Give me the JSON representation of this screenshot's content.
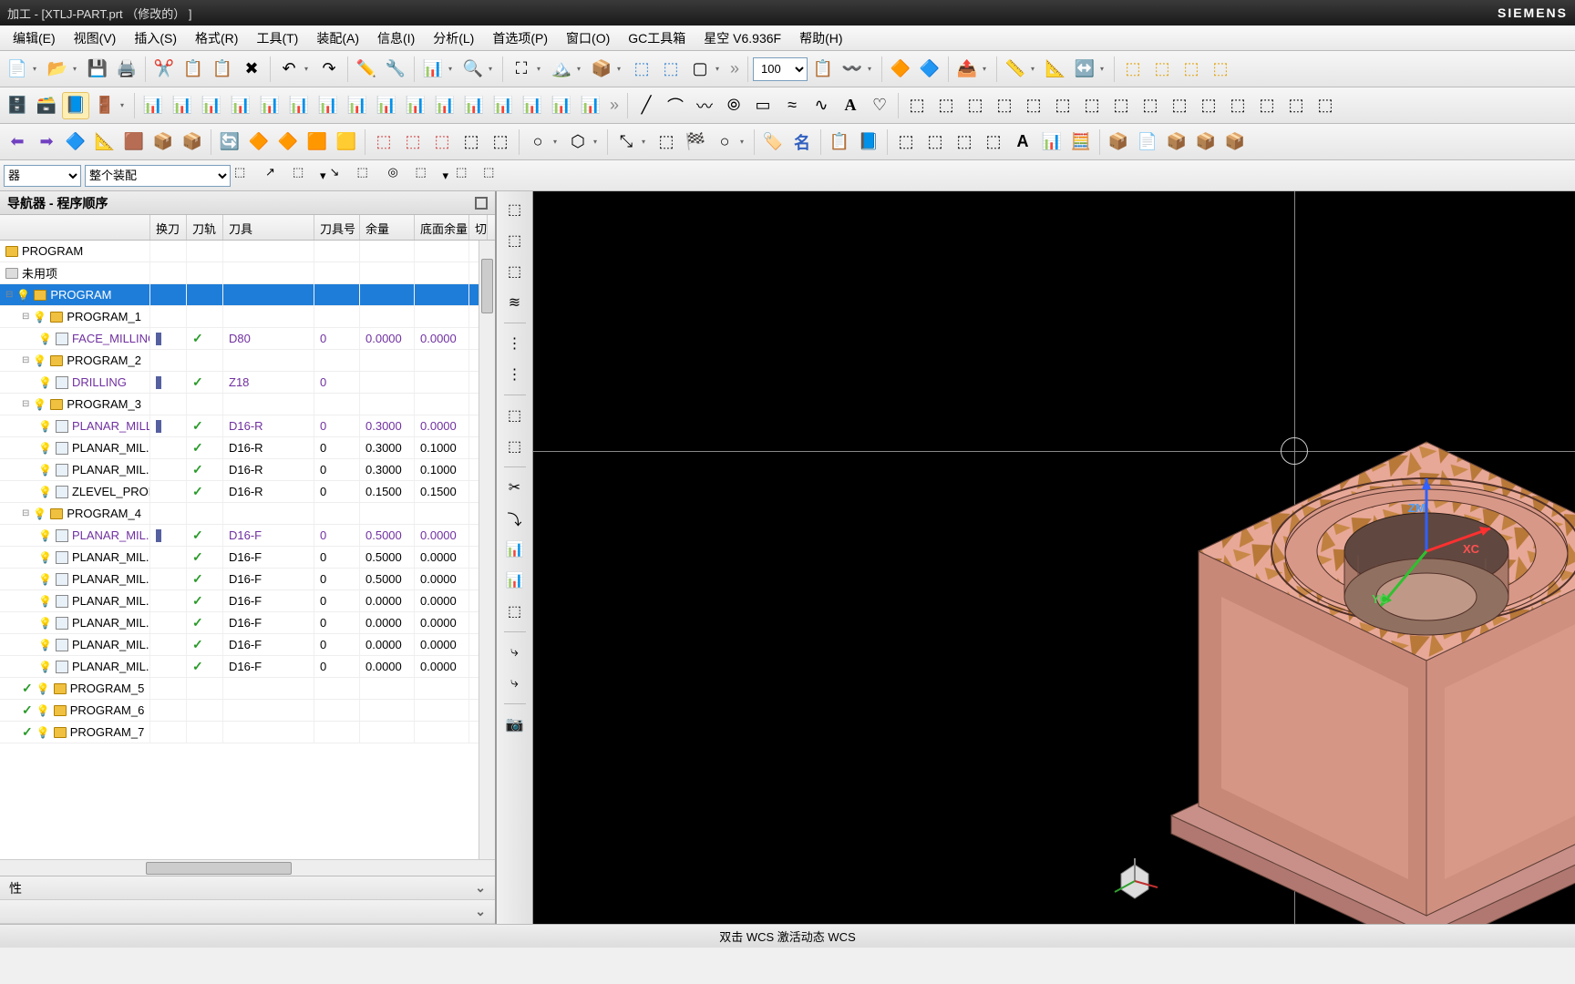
{
  "title": "加工 - [XTLJ-PART.prt  （修改的） ]",
  "brand": "SIEMENS",
  "menu": [
    "编辑(E)",
    "视图(V)",
    "插入(S)",
    "格式(R)",
    "工具(T)",
    "装配(A)",
    "信息(I)",
    "分析(L)",
    "首选项(P)",
    "窗口(O)",
    "GC工具箱",
    "星空    V6.936F",
    "帮助(H)"
  ],
  "zoom_value": "100",
  "sel_mode": "器",
  "sel_scope": "整个装配",
  "nav_title": "导航器 - 程序顺序",
  "cols": {
    "name": "",
    "tc": "换刀",
    "tp": "刀轨",
    "tool": "刀具",
    "tn": "刀具号",
    "stk": "余量",
    "bstk": "底面余量",
    "cut": "切"
  },
  "rows": [
    {
      "lvl": 0,
      "type": "root",
      "name": "PROGRAM",
      "cls": ""
    },
    {
      "lvl": 0,
      "type": "grp",
      "name": "未用项",
      "cls": ""
    },
    {
      "lvl": 0,
      "type": "prog",
      "name": "PROGRAM",
      "cls": "sel"
    },
    {
      "lvl": 1,
      "type": "prog",
      "name": "PROGRAM_1",
      "cls": ""
    },
    {
      "lvl": 2,
      "type": "op",
      "name": "FACE_MILLING",
      "tc": "|",
      "tp": "✓",
      "tool": "D80",
      "tn": "0",
      "stk": "0.0000",
      "bstk": "0.0000",
      "cls": "purp"
    },
    {
      "lvl": 1,
      "type": "prog",
      "name": "PROGRAM_2",
      "cls": ""
    },
    {
      "lvl": 2,
      "type": "op",
      "name": "DRILLING",
      "tc": "/",
      "tp": "✓",
      "tool": "Z18",
      "tn": "0",
      "stk": "",
      "bstk": "",
      "cls": "purp"
    },
    {
      "lvl": 1,
      "type": "prog",
      "name": "PROGRAM_3",
      "cls": ""
    },
    {
      "lvl": 2,
      "type": "op",
      "name": "PLANAR_MILL",
      "tc": "|",
      "tp": "✓",
      "tool": "D16-R",
      "tn": "0",
      "stk": "0.3000",
      "bstk": "0.0000",
      "cls": "purp"
    },
    {
      "lvl": 2,
      "type": "op",
      "name": "PLANAR_MIL...",
      "tp": "✓",
      "tool": "D16-R",
      "tn": "0",
      "stk": "0.3000",
      "bstk": "0.1000",
      "cls": ""
    },
    {
      "lvl": 2,
      "type": "op",
      "name": "PLANAR_MIL...",
      "tp": "✓",
      "tool": "D16-R",
      "tn": "0",
      "stk": "0.3000",
      "bstk": "0.1000",
      "cls": ""
    },
    {
      "lvl": 2,
      "type": "op",
      "name": "ZLEVEL_PROF...",
      "tp": "✓",
      "tool": "D16-R",
      "tn": "0",
      "stk": "0.1500",
      "bstk": "0.1500",
      "cls": ""
    },
    {
      "lvl": 1,
      "type": "prog",
      "name": "PROGRAM_4",
      "cls": ""
    },
    {
      "lvl": 2,
      "type": "op",
      "name": "PLANAR_MIL...",
      "tc": "|",
      "tp": "✓",
      "tool": "D16-F",
      "tn": "0",
      "stk": "0.5000",
      "bstk": "0.0000",
      "cls": "purp"
    },
    {
      "lvl": 2,
      "type": "op",
      "name": "PLANAR_MIL...",
      "tp": "✓",
      "tool": "D16-F",
      "tn": "0",
      "stk": "0.5000",
      "bstk": "0.0000",
      "cls": ""
    },
    {
      "lvl": 2,
      "type": "op",
      "name": "PLANAR_MIL...",
      "tp": "✓",
      "tool": "D16-F",
      "tn": "0",
      "stk": "0.5000",
      "bstk": "0.0000",
      "cls": ""
    },
    {
      "lvl": 2,
      "type": "op",
      "name": "PLANAR_MIL...",
      "tp": "✓",
      "tool": "D16-F",
      "tn": "0",
      "stk": "0.0000",
      "bstk": "0.0000",
      "cls": ""
    },
    {
      "lvl": 2,
      "type": "op",
      "name": "PLANAR_MIL...",
      "tp": "✓",
      "tool": "D16-F",
      "tn": "0",
      "stk": "0.0000",
      "bstk": "0.0000",
      "cls": ""
    },
    {
      "lvl": 2,
      "type": "op",
      "name": "PLANAR_MIL...",
      "tp": "✓",
      "tool": "D16-F",
      "tn": "0",
      "stk": "0.0000",
      "bstk": "0.0000",
      "cls": ""
    },
    {
      "lvl": 2,
      "type": "op",
      "name": "PLANAR_MIL...",
      "tp": "✓",
      "tool": "D16-F",
      "tn": "0",
      "stk": "0.0000",
      "bstk": "0.0000",
      "cls": ""
    },
    {
      "lvl": 1,
      "type": "prog",
      "name": "PROGRAM_5",
      "cls": "",
      "chk": true
    },
    {
      "lvl": 1,
      "type": "prog",
      "name": "PROGRAM_6",
      "cls": "",
      "chk": true
    },
    {
      "lvl": 1,
      "type": "prog",
      "name": "PROGRAM_7",
      "cls": "",
      "chk": true
    }
  ],
  "panel_prop": "性",
  "panel_detail": "",
  "wcs_axis": {
    "zm": "ZM",
    "xc": "XC",
    "yc": "YC"
  },
  "status_text": "双击 WCS 激活动态 WCS",
  "colors": {
    "part_top": "#e8a898",
    "part_tex": "#c08040",
    "part_side": "#d89888",
    "sel_row": "#1e7dd9"
  }
}
